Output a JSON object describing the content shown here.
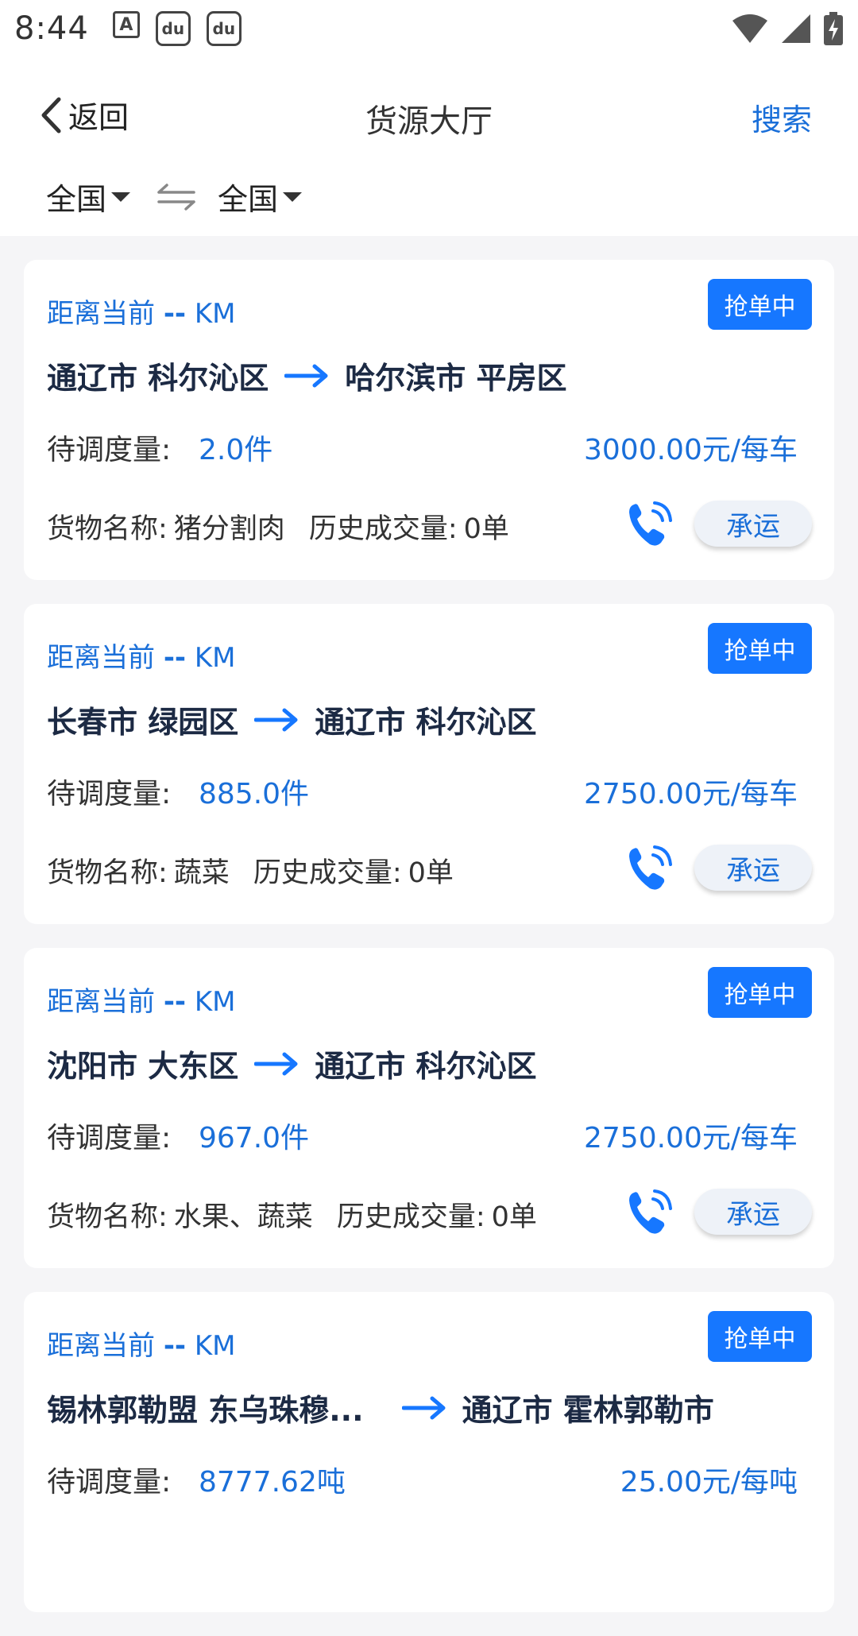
{
  "status_bar": {
    "time": "8:44"
  },
  "header": {
    "back_label": "返回",
    "title": "货源大厅",
    "search_label": "搜索"
  },
  "filters": {
    "origin": "全国",
    "destination": "全国"
  },
  "common": {
    "distance_label": "距离当前",
    "distance_value": "--",
    "distance_unit": "KM",
    "qty_label": "待调度量:",
    "goods_label": "货物名称:",
    "history_label": "历史成交量:",
    "carry_label": "承运"
  },
  "cards": [
    {
      "badge": "抢单中",
      "from": "通辽市 科尔沁区",
      "to": "哈尔滨市 平房区",
      "qty": "2.0件",
      "price": "3000.00元/每车",
      "goods": "猪分割肉",
      "history": "0单"
    },
    {
      "badge": "抢单中",
      "from": "长春市 绿园区",
      "to": "通辽市 科尔沁区",
      "qty": "885.0件",
      "price": "2750.00元/每车",
      "goods": "蔬菜",
      "history": "0单"
    },
    {
      "badge": "抢单中",
      "from": "沈阳市 大东区",
      "to": "通辽市 科尔沁区",
      "qty": "967.0件",
      "price": "2750.00元/每车",
      "goods": "水果、蔬菜",
      "history": "0单"
    },
    {
      "badge": "抢单中",
      "from": "锡林郭勒盟 东乌珠穆...",
      "to": "通辽市 霍林郭勒市",
      "qty": "8777.62吨",
      "price": "25.00元/每吨"
    }
  ]
}
